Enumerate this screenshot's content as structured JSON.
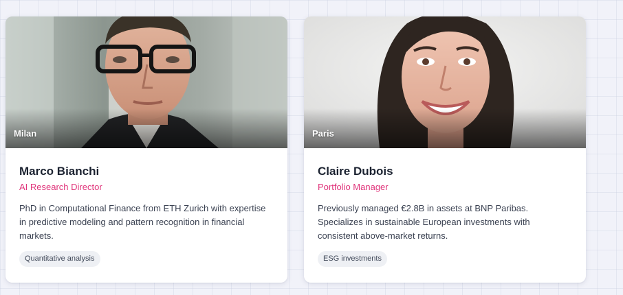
{
  "cards": [
    {
      "location": "Milan",
      "name": "Marco Bianchi",
      "role": "AI Research Director",
      "bio": "PhD in Computational Finance from ETH Zurich with expertise in predictive modeling and pattern recognition in financial markets.",
      "tag": "Quantitative analysis"
    },
    {
      "location": "Paris",
      "name": "Claire Dubois",
      "role": "Portfolio Manager",
      "bio": "Previously managed €2.8B in assets at BNP Paribas. Specializes in sustainable European investments with consistent above-market returns.",
      "tag": "ESG investments"
    }
  ],
  "colors": {
    "accent": "#e0357b",
    "name": "#1b2230",
    "tag_bg": "#eef0f4"
  }
}
